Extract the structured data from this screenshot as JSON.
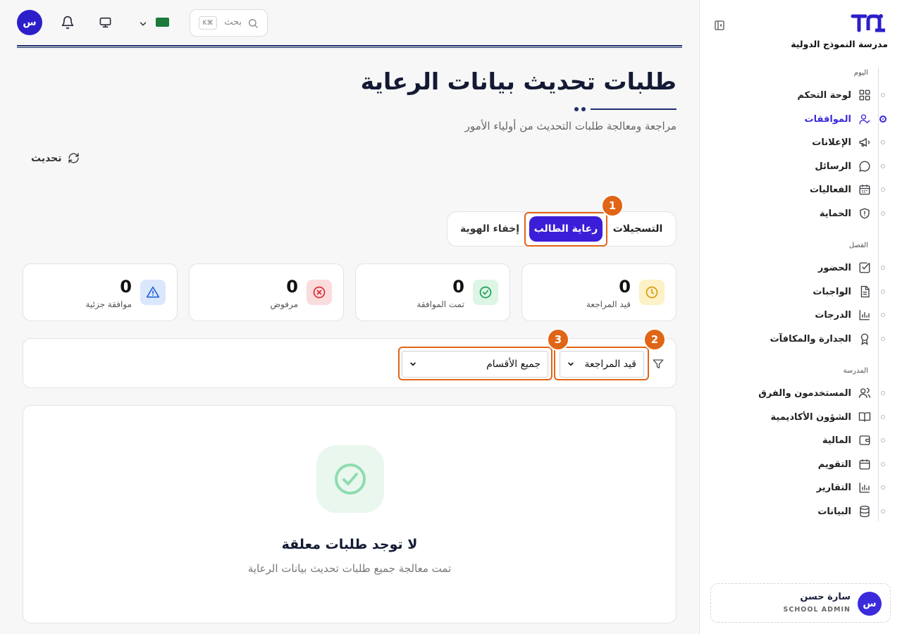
{
  "topbar": {
    "avatar_initial": "س",
    "search_placeholder": "بحث",
    "search_shortcut": "K⌘"
  },
  "header": {
    "title": "طلبات تحديث بيانات الرعاية",
    "subtitle": "مراجعة ومعالجة طلبات التحديث من أولياء الأمور",
    "refresh_label": "تحديث"
  },
  "tabs": [
    {
      "label": "التسجيلات",
      "active": false
    },
    {
      "label": "رعاية الطالب",
      "active": true
    },
    {
      "label": "إخفاء الهوية",
      "active": false
    }
  ],
  "annotations": [
    "1",
    "2",
    "3"
  ],
  "stats": [
    {
      "value": "0",
      "label": "قيد المراجعة",
      "icon": "clock-icon",
      "color": "#f5c542"
    },
    {
      "value": "0",
      "label": "تمت الموافقة",
      "icon": "check-circle-icon",
      "color": "#22a35a"
    },
    {
      "value": "0",
      "label": "مرفوض",
      "icon": "x-circle-icon",
      "color": "#e0333a"
    },
    {
      "value": "0",
      "label": "موافقة جزئية",
      "icon": "warning-icon",
      "color": "#2b6fe0"
    }
  ],
  "filters": {
    "status_selected": "قيد المراجعة",
    "department_selected": "جميع الأقسام"
  },
  "empty_state": {
    "title": "لا توجد طلبات معلقة",
    "subtitle": "تمت معالجة جميع طلبات تحديث بيانات الرعاية"
  },
  "sidebar": {
    "school_name": "مدرسة النموذج الدولية",
    "sections": {
      "today": "اليوم",
      "class": "الفصل",
      "school": "المدرسة"
    },
    "items": [
      {
        "label": "لوحة التحكم",
        "icon": "dashboard-icon"
      },
      {
        "label": "الموافقات",
        "icon": "user-check-icon",
        "active": true
      },
      {
        "label": "الإعلانات",
        "icon": "megaphone-icon"
      },
      {
        "label": "الرسائل",
        "icon": "chat-icon"
      },
      {
        "label": "الفعاليات",
        "icon": "calendar-icon"
      },
      {
        "label": "الحماية",
        "icon": "shield-icon"
      },
      {
        "label": "الحضور",
        "icon": "checkbox-icon"
      },
      {
        "label": "الواجبات",
        "icon": "document-icon"
      },
      {
        "label": "الدرجات",
        "icon": "bar-chart-icon"
      },
      {
        "label": "الجدارة والمكافآت",
        "icon": "award-icon"
      },
      {
        "label": "المستخدمون والفرق",
        "icon": "users-icon"
      },
      {
        "label": "الشؤون الأكاديمية",
        "icon": "book-icon"
      },
      {
        "label": "المالية",
        "icon": "wallet-icon"
      },
      {
        "label": "التقويم",
        "icon": "calendar-icon"
      },
      {
        "label": "التقارير",
        "icon": "bar-chart-icon"
      },
      {
        "label": "البيانات",
        "icon": "database-icon"
      }
    ],
    "user": {
      "initial": "س",
      "name": "سارة حسن",
      "role": "SCHOOL ADMIN"
    }
  }
}
